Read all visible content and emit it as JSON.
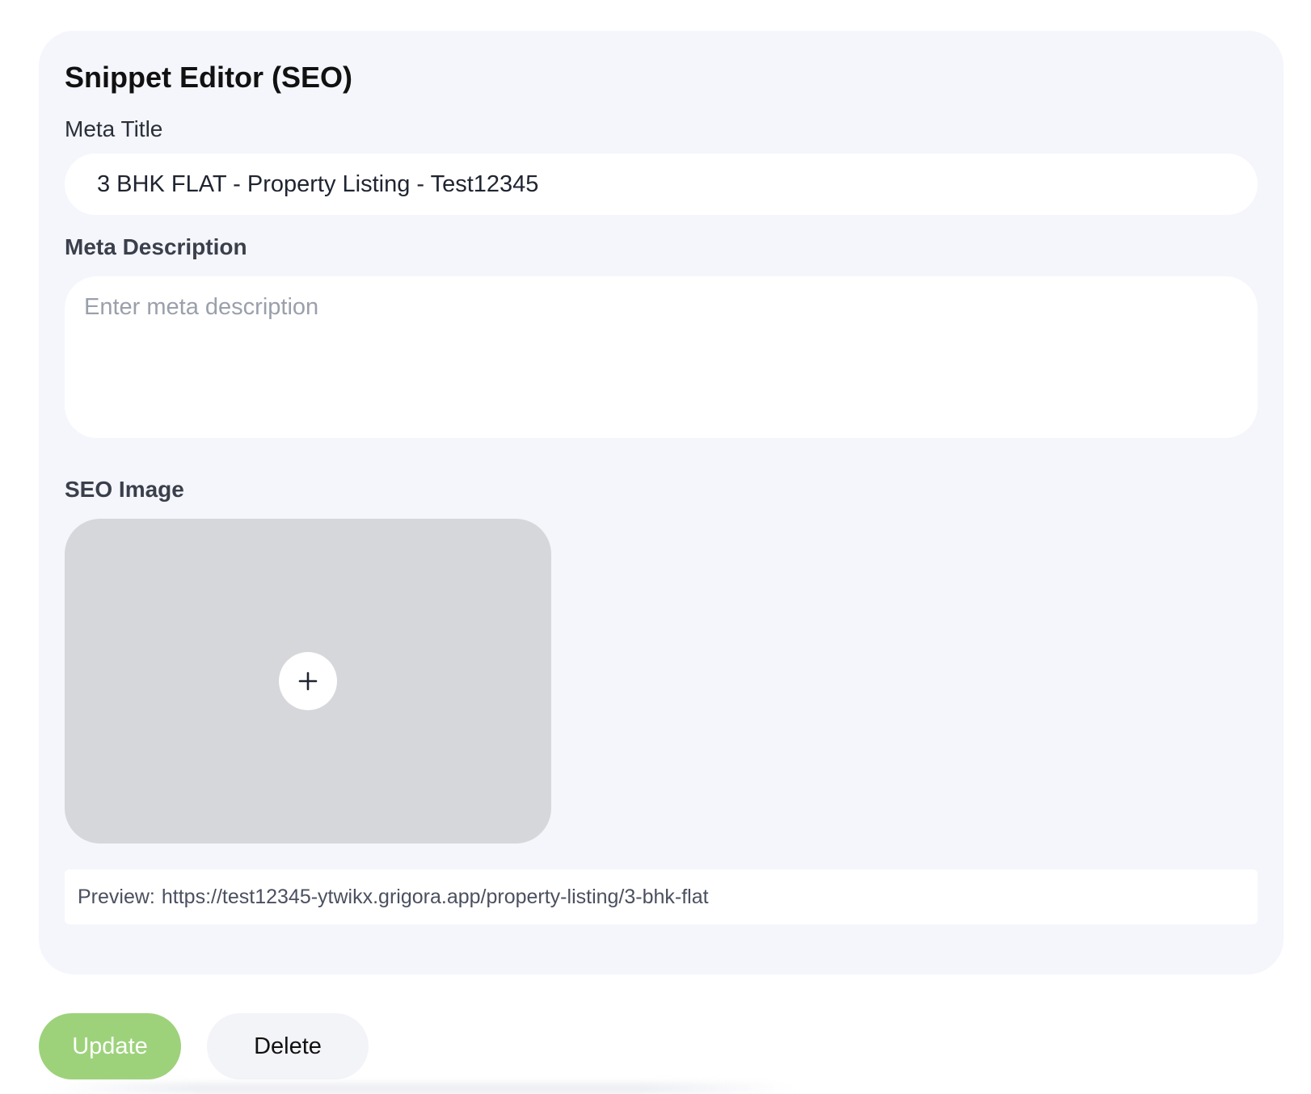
{
  "card": {
    "title": "Snippet Editor (SEO)"
  },
  "meta_title": {
    "label": "Meta Title",
    "value": "3 BHK FLAT - Property Listing - Test12345"
  },
  "meta_description": {
    "label": "Meta Description",
    "value": "",
    "placeholder": "Enter meta description"
  },
  "seo_image": {
    "label": "SEO Image",
    "add_icon": "plus-icon"
  },
  "preview": {
    "prefix": "Preview:",
    "url": "https://test12345-ytwikx.grigora.app/property-listing/3-bhk-flat"
  },
  "actions": {
    "update_label": "Update",
    "delete_label": "Delete"
  },
  "colors": {
    "card_background": "#f4f6fb",
    "update_button": "#9dd27b",
    "delete_button": "#f3f4f8",
    "image_placeholder": "#d6d7db"
  }
}
